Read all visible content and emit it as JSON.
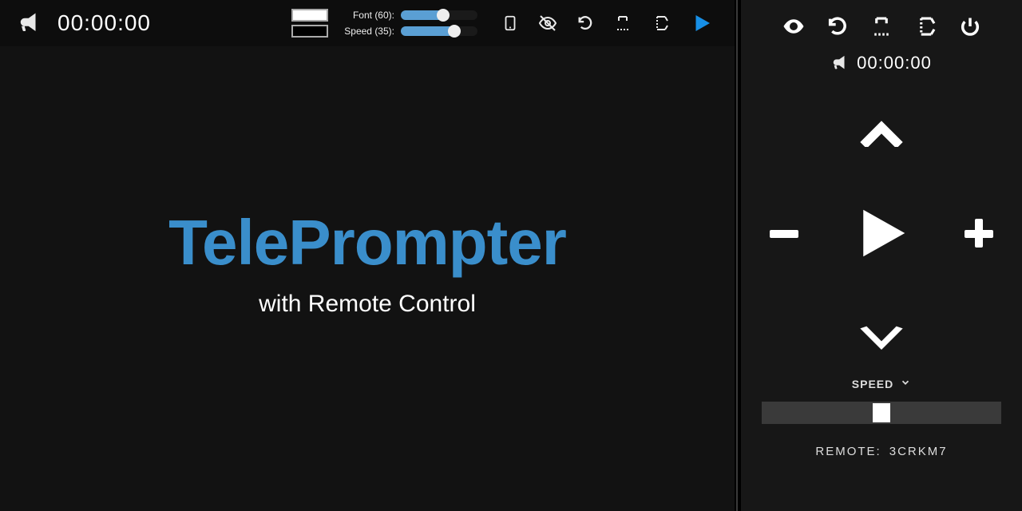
{
  "header": {
    "timer": "00:00:00",
    "font_label": "Font (60):",
    "speed_label": "Speed (35):",
    "font_value": 60,
    "font_min": 10,
    "font_max": 100,
    "speed_value": 35,
    "speed_min": 0,
    "speed_max": 50
  },
  "content": {
    "title": "TelePrompter",
    "subtitle": "with Remote Control"
  },
  "remote": {
    "timer": "00:00:00",
    "speed_label": "SPEED",
    "remote_label": "REMOTE:",
    "remote_code": "3CRKM7",
    "slider_value": 50,
    "slider_min": 0,
    "slider_max": 100
  }
}
